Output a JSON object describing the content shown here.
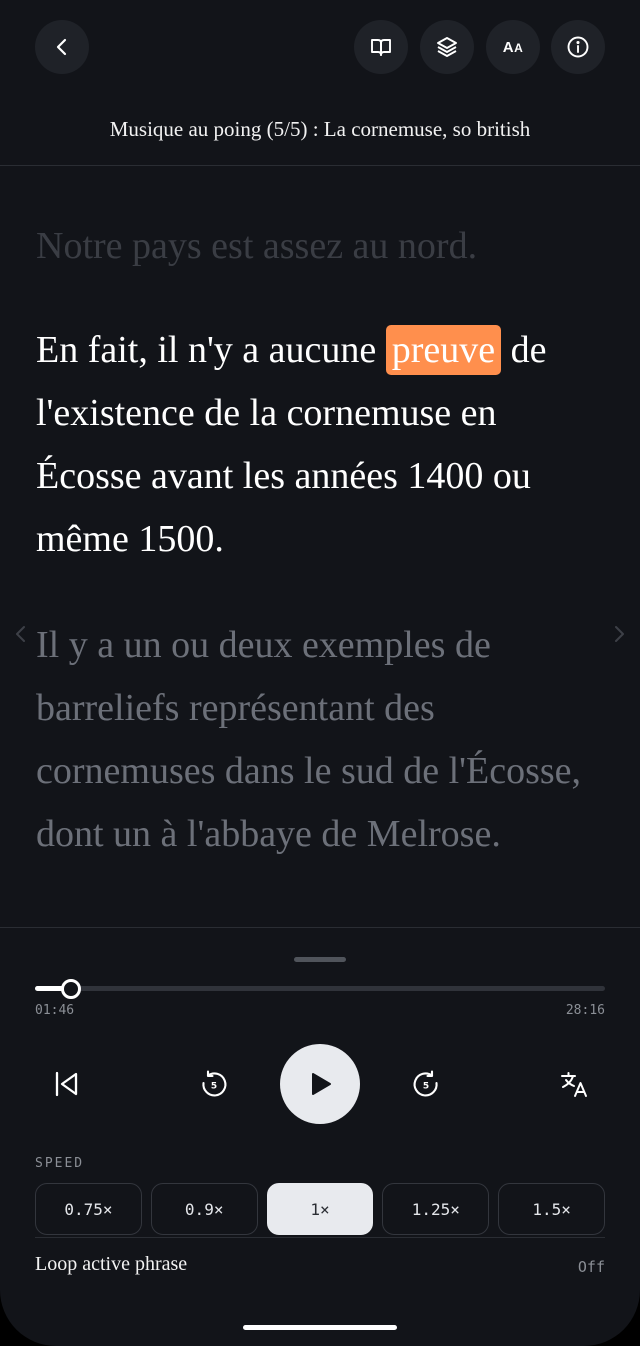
{
  "header": {
    "title": "Musique au poing (5/5) : La cornemuse, so british",
    "icons": [
      "back-icon",
      "book-icon",
      "layers-icon",
      "text-size-icon",
      "info-icon"
    ],
    "text_size_label_big": "A",
    "text_size_label_small": "A"
  },
  "reading": {
    "previous": "Notre pays est assez au nord.",
    "active_before": "En fait, il n'y a aucune ",
    "active_highlight": "preuve",
    "active_after": " de l'existence de la cornemuse en Écosse avant les années 1400 ou même 1500.",
    "next": "Il y a un ou deux exemples de barreliefs représentant des cornemuses dans le sud de l'Écosse, dont un à l'abbaye de Melrose."
  },
  "player": {
    "elapsed": "01:46",
    "duration": "28:16",
    "progress": 0.0625,
    "skip_back_seconds": "5",
    "skip_forward_seconds": "5"
  },
  "speed": {
    "label": "SPEED",
    "options": [
      "0.75×",
      "0.9×",
      "1×",
      "1.25×",
      "1.5×"
    ],
    "selected": "1×"
  },
  "loop": {
    "label": "Loop active phrase",
    "value": "Off"
  },
  "colors": {
    "background": "#121419",
    "highlight": "#ff8f4d",
    "button": "#1f2228",
    "play": "#e8eaee"
  }
}
